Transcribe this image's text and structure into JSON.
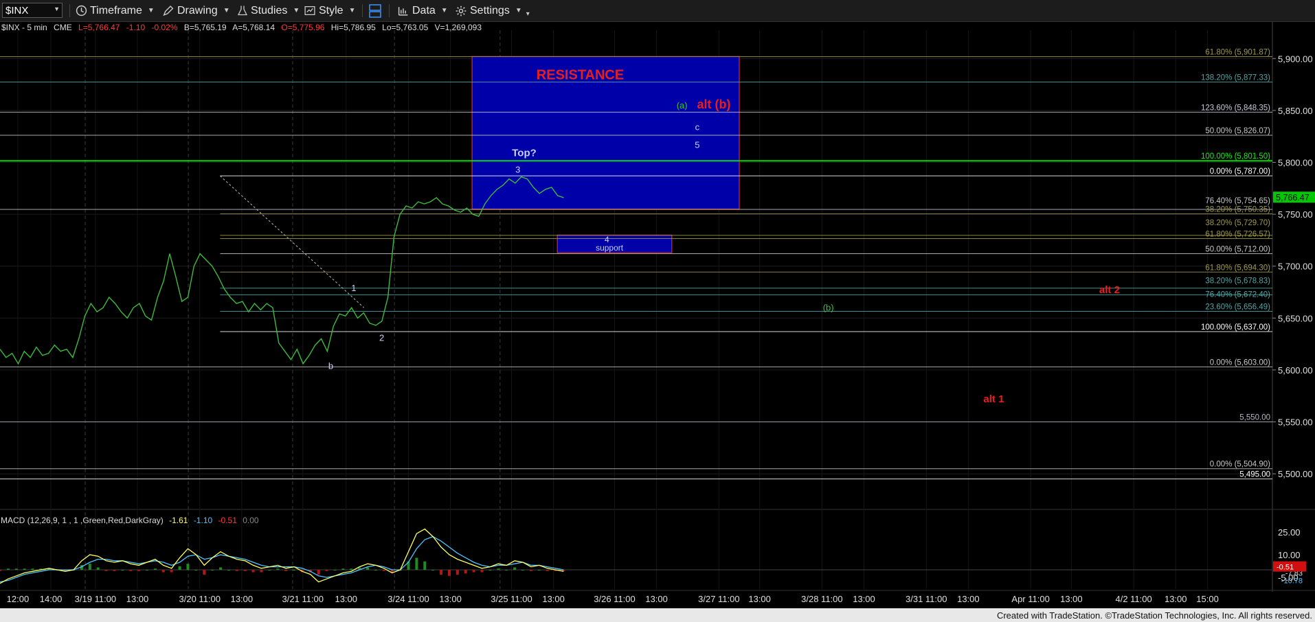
{
  "toolbar": {
    "symbol": "$INX",
    "timeframe": "Timeframe",
    "drawing": "Drawing",
    "studies": "Studies",
    "style": "Style",
    "data": "Data",
    "settings": "Settings"
  },
  "info_bar": {
    "symbol_tf": "$INX - 5 min",
    "exchange": "CME",
    "last": "L=5,766.47",
    "chg": "-1.10",
    "pct": "-0.02%",
    "bid": "B=5,765.19",
    "ask": "A=5,768.14",
    "open": "O=5,775.96",
    "high": "Hi=5,786.95",
    "low": "Lo=5,763.05",
    "volume": "V=1,269,093"
  },
  "colors": {
    "up": "#00d000",
    "down": "#ff2a2a",
    "resistance_box": "#0000a8",
    "price_bars": "#3dbb3d",
    "macd_line": "#ffff66",
    "macd_signal": "#4fc4ff",
    "macd_hist_up": "#1e8c1e",
    "macd_hist_down": "#b01818",
    "current_price": "#00c800"
  },
  "macd_label": {
    "title": "MACD (12,26,9, 1 , 1 ,Green,Red,DarkGray)",
    "v1": "-1.61",
    "v2": "-1.10",
    "v3": "-0.51",
    "v4": "0.00"
  },
  "footer": "Created with TradeStation. ©TradeStation Technologies, Inc. All rights reserved.",
  "chart_data": {
    "type": "line",
    "title": "$INX - 5 min",
    "price_axis": {
      "ylim": [
        5467,
        5922
      ],
      "ticks": [
        "5,900.00",
        "5,850.00",
        "5,800.00",
        "5,750.00",
        "5,700.00",
        "5,650.00",
        "5,600.00",
        "5,550.00",
        "5,500.00"
      ],
      "tick_values": [
        5900,
        5850,
        5800,
        5750,
        5700,
        5650,
        5600,
        5550,
        5500
      ],
      "current_price": 5766.47,
      "current_label": "5,766.47"
    },
    "time_axis": {
      "labels": [
        "12:00",
        "14:00",
        "3/19 11:00",
        "13:00",
        "3/20 11:00",
        "13:00",
        "3/21 11:00",
        "13:00",
        "3/24 11:00",
        "13:00",
        "3/25 11:00",
        "13:00",
        "3/26 11:00",
        "13:00",
        "3/27 11:00",
        "13:00",
        "3/28 11:00",
        "13:00",
        "3/31 11:00",
        "13:00",
        "Apr 11:00",
        "13:00",
        "4/2 11:00",
        "13:00",
        "15:00"
      ],
      "positions": [
        0.014,
        0.04,
        0.075,
        0.108,
        0.157,
        0.19,
        0.238,
        0.272,
        0.321,
        0.354,
        0.402,
        0.435,
        0.483,
        0.516,
        0.565,
        0.597,
        0.646,
        0.679,
        0.728,
        0.761,
        0.81,
        0.842,
        0.891,
        0.924,
        0.949
      ],
      "date_dividers": [
        0.067,
        0.148,
        0.23,
        0.31,
        0.393
      ]
    },
    "series": [
      {
        "name": "$INX",
        "y": [
          5620,
          5612,
          5616,
          5606,
          5618,
          5612,
          5622,
          5614,
          5616,
          5624,
          5618,
          5620,
          5612,
          5630,
          5652,
          5664,
          5656,
          5660,
          5670,
          5664,
          5656,
          5650,
          5660,
          5664,
          5652,
          5648,
          5670,
          5686,
          5712,
          5690,
          5666,
          5670,
          5700,
          5712,
          5706,
          5700,
          5690,
          5678,
          5670,
          5664,
          5666,
          5656,
          5664,
          5658,
          5664,
          5660,
          5626,
          5618,
          5610,
          5620,
          5606,
          5614,
          5624,
          5630,
          5618,
          5642,
          5654,
          5652,
          5660,
          5650,
          5655,
          5645,
          5643,
          5647,
          5670,
          5728,
          5750,
          5758,
          5756,
          5762,
          5760,
          5762,
          5766,
          5760,
          5758,
          5754,
          5752,
          5756,
          5750,
          5748,
          5760,
          5768,
          5774,
          5778,
          5784,
          5780,
          5786,
          5784,
          5776,
          5770,
          5774,
          5776,
          5768,
          5766
        ]
      }
    ],
    "fib_levels": [
      {
        "label": "61.80% (5,901.87)",
        "value": 5901.87,
        "color": "#a09a45"
      },
      {
        "label": "138.20% (5,877.33)",
        "value": 5877.33,
        "color": "#4fa8a8"
      },
      {
        "label": "123.60% (5,848.35)",
        "value": 5848.35,
        "color": "#c8c8d8"
      },
      {
        "label": "50.00% (5,826.07)",
        "value": 5826.07,
        "color": "#c8c8c8"
      },
      {
        "label": "100.00% (5,801.50)",
        "value": 5801.5,
        "color": "#00ff00"
      },
      {
        "label": "0.00% (5,787.00)",
        "value": 5787.0,
        "color": "#ffffff"
      },
      {
        "label": "76.40% (5,754.65)",
        "value": 5754.65,
        "color": "#c8c8c8"
      },
      {
        "label": "38.20% (5,750.35)",
        "value": 5750.35,
        "color": "#a09a45"
      },
      {
        "label": "38.20% (5,729.70)",
        "value": 5729.7,
        "color": "#a09a45"
      },
      {
        "label": "61.80% (5,726.57)",
        "value": 5726.57,
        "color": "#a09a45"
      },
      {
        "label": "50.00% (5,712.00)",
        "value": 5712.0,
        "color": "#c8c8c8"
      },
      {
        "label": "61.80% (5,694.30)",
        "value": 5694.3,
        "color": "#a09a45"
      },
      {
        "label": "38.20% (5,678.83)",
        "value": 5678.83,
        "color": "#4fa8a8"
      },
      {
        "label": "76.40% (5,672.40)",
        "value": 5672.4,
        "color": "#4fa8a8"
      },
      {
        "label": "23.60% (5,656.49)",
        "value": 5656.49,
        "color": "#4fa8a8"
      },
      {
        "label": "100.00% (5,637.00)",
        "value": 5637.0,
        "color": "#ffffff"
      },
      {
        "label": "0.00% (5,603.00)",
        "value": 5603.0,
        "color": "#c8c8c8"
      },
      {
        "label": "5,550.00",
        "value": 5550.0,
        "color": "#b0b8c8"
      },
      {
        "label": "0.00% (5,504.90)",
        "value": 5504.9,
        "color": "#c8c8c8"
      },
      {
        "label": "5,495.00",
        "value": 5495.0,
        "color": "#ffffff"
      }
    ],
    "annotations": [
      {
        "text": "RESISTANCE",
        "color": "#e81e1e"
      },
      {
        "text": "(a)",
        "color": "#2ecc2e"
      },
      {
        "text": "alt (b)",
        "color": "#e81e1e"
      },
      {
        "text": "c",
        "color": "#c8d0ff"
      },
      {
        "text": "5",
        "color": "#c8d0ff"
      },
      {
        "text": "Top?",
        "color": "#c8d0ff"
      },
      {
        "text": "3",
        "color": "#c8d0ff"
      },
      {
        "text": "4",
        "color": "#c8d0ff"
      },
      {
        "text": "support",
        "color": "#c8d0ff"
      },
      {
        "text": "1",
        "color": "#c8d0ff"
      },
      {
        "text": "2",
        "color": "#c8d0ff"
      },
      {
        "text": "b",
        "color": "#c8d0ff"
      },
      {
        "text": "(b)",
        "color": "#2ecc2e"
      },
      {
        "text": "alt 2",
        "color": "#e81e1e"
      },
      {
        "text": "alt 1",
        "color": "#e81e1e"
      }
    ],
    "zones": [
      {
        "name": "resistance",
        "top": 5902,
        "bottom": 5755
      },
      {
        "name": "support",
        "top": 5730,
        "bottom": 5713
      }
    ],
    "macd": {
      "ticks": [
        "25.00",
        "10.00",
        "-5.00"
      ],
      "tick_values": [
        25,
        10,
        -5
      ],
      "ylim": [
        -10,
        30
      ],
      "readouts": [
        "-7.83",
        "-10.78",
        "-0.51"
      ],
      "macd": [
        -9,
        -6,
        -4,
        -2,
        -1,
        0,
        1,
        0,
        -1,
        0,
        6,
        10,
        9,
        6,
        5,
        6,
        4,
        3,
        5,
        7,
        3,
        1,
        8,
        14,
        10,
        3,
        8,
        12,
        9,
        7,
        6,
        3,
        1,
        2,
        3,
        1,
        2,
        -1,
        -3,
        -8,
        -6,
        -4,
        -2,
        -1,
        2,
        4,
        3,
        1,
        -2,
        0,
        12,
        24,
        27,
        22,
        15,
        10,
        7,
        5,
        3,
        1,
        2,
        4,
        3,
        6,
        5,
        2,
        3,
        1,
        0,
        -1
      ],
      "signal": [
        -8,
        -7,
        -5,
        -3,
        -2,
        -1,
        0,
        0,
        0,
        0,
        2,
        5,
        7,
        7,
        6,
        6,
        5,
        4,
        5,
        6,
        5,
        3,
        5,
        9,
        10,
        7,
        8,
        10,
        9,
        8,
        7,
        5,
        3,
        2,
        2,
        2,
        2,
        1,
        -1,
        -4,
        -5,
        -4,
        -3,
        -2,
        0,
        2,
        3,
        2,
        0,
        0,
        5,
        14,
        20,
        22,
        19,
        15,
        11,
        8,
        5,
        3,
        2,
        3,
        3,
        4,
        5,
        3,
        3,
        2,
        1,
        0
      ]
    }
  }
}
